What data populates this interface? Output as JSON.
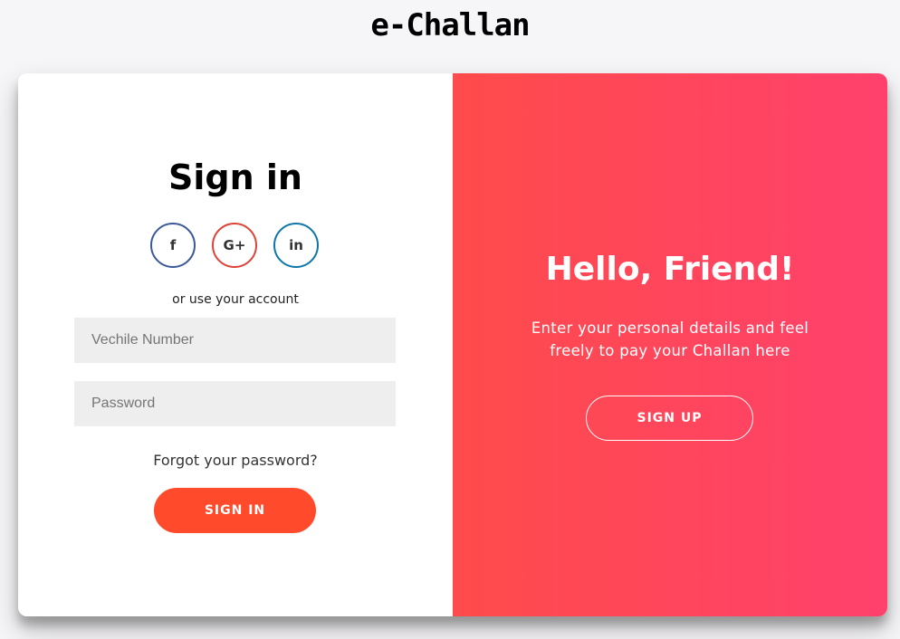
{
  "app": {
    "title": "e-Challan"
  },
  "signin": {
    "heading": "Sign in",
    "social": [
      {
        "icon": "facebook-icon",
        "glyph": "f",
        "color": "#3b5998"
      },
      {
        "icon": "google-plus-icon",
        "glyph": "G+",
        "color": "#db4437"
      },
      {
        "icon": "linkedin-icon",
        "glyph": "in",
        "color": "#0e76a8"
      }
    ],
    "alt_text": "or use your account",
    "vehicle_placeholder": "Vechile Number",
    "password_placeholder": "Password",
    "forgot_label": "Forgot your password?",
    "button_label": "SIGN IN",
    "button_color": "#ff4b2b"
  },
  "overlay": {
    "heading": "Hello, Friend!",
    "text": "Enter your personal details and feel freely to pay your Challan here",
    "button_label": "SIGN UP",
    "gradient_start": "#ff4b4b",
    "gradient_end": "#ff416c"
  }
}
